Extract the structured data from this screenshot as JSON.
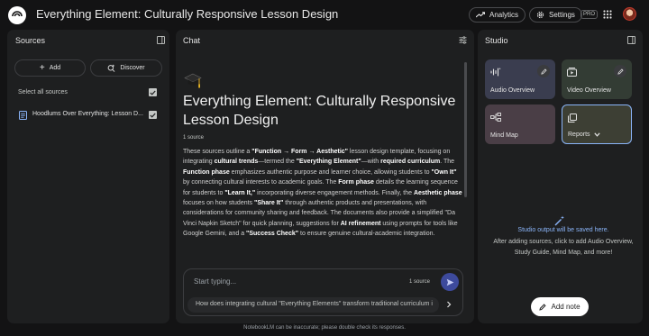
{
  "header": {
    "title": "Everything Element: Culturally Responsive Lesson Design",
    "analytics_label": "Analytics",
    "settings_label": "Settings",
    "pro_badge": "PRO"
  },
  "sources": {
    "title": "Sources",
    "add_label": "Add",
    "discover_label": "Discover",
    "select_all_label": "Select all sources",
    "items": [
      {
        "name": "Hoodlums Over Everything: Lesson D..."
      }
    ]
  },
  "chat": {
    "title": "Chat",
    "notebook_title": "Everything Element: Culturally Responsive Lesson Design",
    "source_count": "1 source",
    "summary_parts": [
      {
        "t": "These sources outline a ",
        "b": false
      },
      {
        "t": "\"Function → Form → Aesthetic\"",
        "b": true
      },
      {
        "t": " lesson design template, focusing on integrating ",
        "b": false
      },
      {
        "t": "cultural trends",
        "b": true
      },
      {
        "t": "—termed the ",
        "b": false
      },
      {
        "t": "\"Everything Element\"",
        "b": true
      },
      {
        "t": "—with ",
        "b": false
      },
      {
        "t": "required curriculum",
        "b": true
      },
      {
        "t": ". The ",
        "b": false
      },
      {
        "t": "Function phase",
        "b": true
      },
      {
        "t": " emphasizes authentic purpose and learner choice, allowing students to ",
        "b": false
      },
      {
        "t": "\"Own It\"",
        "b": true
      },
      {
        "t": " by connecting cultural interests to academic goals. The ",
        "b": false
      },
      {
        "t": "Form phase",
        "b": true
      },
      {
        "t": " details the learning sequence for students to ",
        "b": false
      },
      {
        "t": "\"Learn It,\"",
        "b": true
      },
      {
        "t": " incorporating diverse engagement methods. Finally, the ",
        "b": false
      },
      {
        "t": "Aesthetic phase",
        "b": true
      },
      {
        "t": " focuses on how students ",
        "b": false
      },
      {
        "t": "\"Share It\"",
        "b": true
      },
      {
        "t": " through authentic products and presentations, with considerations for community sharing and feedback. The documents also provide a simplified \"Da Vinci Napkin Sketch\" for quick planning, suggestions for ",
        "b": false
      },
      {
        "t": "AI refinement",
        "b": true
      },
      {
        "t": " using prompts for tools like Google Gemini, and a ",
        "b": false
      },
      {
        "t": "\"Success Check\"",
        "b": true
      },
      {
        "t": " to ensure genuine cultural-academic integration.",
        "b": false
      }
    ],
    "input_placeholder": "Start typing...",
    "input_source_count": "1 source",
    "suggestion": "How does integrating cultural \"Everything Elements\" transform traditional curriculum i"
  },
  "studio": {
    "title": "Studio",
    "tiles": [
      {
        "label": "Audio Overview",
        "color": "#3a3d4f",
        "icon": "audio-waveform-icon"
      },
      {
        "label": "Video Overview",
        "color": "#333c34",
        "icon": "video-play-icon"
      },
      {
        "label": "Mind Map",
        "color": "#4a3e46",
        "icon": "mind-map-icon"
      },
      {
        "label": "Reports",
        "color": "#3d3f34",
        "icon": "reports-icon"
      }
    ],
    "saved_text": "Studio output will be saved here.",
    "desc_text": "After adding sources, click to add Audio Overview, Study Guide, Mind Map, and more!",
    "add_note_label": "Add note"
  },
  "footer": {
    "disclaimer": "NotebookLM can be inaccurate; please double check its responses."
  },
  "colors": {
    "background": "#131314",
    "panel": "#1e1f20",
    "accent": "#8ab4f8",
    "send": "#3d4a9c"
  }
}
